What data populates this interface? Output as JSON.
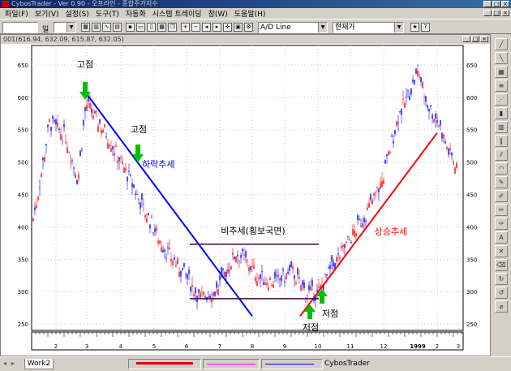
{
  "window": {
    "title": "CybosTrader - Ver 0.90 - 오프라인 - 종합주가지수"
  },
  "menu": [
    "파일(F)",
    "보기(V)",
    "설정(S)",
    "도구(T)",
    "자동화",
    "시스템 트레이딩",
    "창(W)",
    "도움말(H)"
  ],
  "toolbar": {
    "code_value": "",
    "period_label": "일",
    "line_type": "A/D Line",
    "price_type": "현재가"
  },
  "chart": {
    "header": "001(616.94, 632.09, 615.87, 632.05)",
    "y_ticks": [
      "650",
      "600",
      "550",
      "500",
      "450",
      "400",
      "350",
      "300",
      "250"
    ],
    "x_ticks": [
      "2",
      "3",
      "4",
      "5",
      "6",
      "7",
      "8",
      "9",
      "10",
      "11",
      "12",
      "1999",
      "2",
      "3"
    ],
    "annotations": {
      "high1": "고점",
      "high2": "고점",
      "downtrend": "하락추세",
      "sideways": "비추세(횡보국면)",
      "uptrend": "상승추세",
      "low1": "저점",
      "low2": "저점"
    }
  },
  "chart_data": {
    "type": "candlestick",
    "ylim": [
      240,
      680
    ],
    "x": [
      "2",
      "3",
      "4",
      "5",
      "6",
      "7",
      "8",
      "9",
      "10",
      "11",
      "12",
      "1999",
      "2",
      "3"
    ],
    "close_approx": [
      420,
      580,
      530,
      460,
      330,
      290,
      370,
      310,
      300,
      340,
      450,
      640,
      540,
      520
    ],
    "trendlines": [
      {
        "name": "하락추세",
        "from": [
          "3",
          605
        ],
        "to": [
          "8",
          262
        ]
      },
      {
        "name": "상승추세",
        "from": [
          "10",
          262
        ],
        "to": [
          "2",
          545
        ]
      }
    ],
    "channel": {
      "upper": 373,
      "lower": 289,
      "from": "6",
      "to": "11"
    }
  },
  "status": {
    "tab": "Work2",
    "app": "CybosTrader"
  },
  "colors": {
    "downtrend": "#0000ff",
    "uptrend": "#ff0000",
    "arrows": "#00c000",
    "channel": "#400040",
    "candle_up": "#ff0000",
    "candle_down": "#0000ff"
  }
}
